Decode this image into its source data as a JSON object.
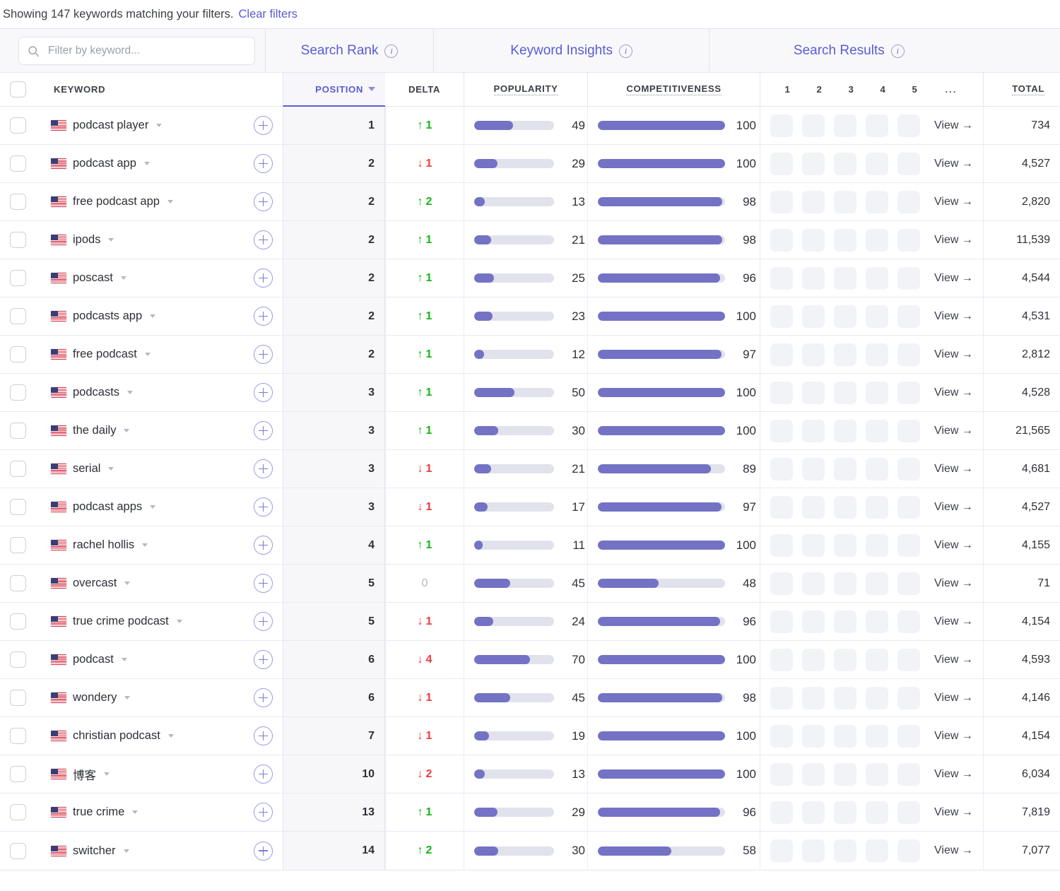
{
  "status": {
    "text": "Showing 147 keywords matching your filters.",
    "clear_label": "Clear filters"
  },
  "search": {
    "placeholder": "Filter by keyword...",
    "value": "",
    "icon": "search-icon"
  },
  "group_headers": [
    {
      "label": "Search Rank",
      "info_icon": "info-icon"
    },
    {
      "label": "Keyword Insights",
      "info_icon": "info-icon"
    },
    {
      "label": "Search Results",
      "info_icon": "info-icon"
    }
  ],
  "columns": {
    "keyword": "KEYWORD",
    "position": "POSITION",
    "position_sort_icon": "chevron-down-icon",
    "delta": "DELTA",
    "popularity": "POPULARITY",
    "competitiveness": "COMPETITIVENESS",
    "rank_slots": [
      "1",
      "2",
      "3",
      "4",
      "5"
    ],
    "rank_more": "...",
    "total": "TOTAL"
  },
  "row_actions": {
    "add_icon": "plus-icon",
    "view_label": "View →",
    "keyword_caret_icon": "caret-down-icon",
    "flag_icon": "us-flag-icon"
  },
  "colors": {
    "accent": "#5b5bd6",
    "bar_fill": "#7472c4",
    "bar_track": "#e2e2ed",
    "delta_up": "#16b516",
    "delta_down": "#ef3b3b",
    "delta_zero": "#b3b6bf",
    "placeholder_box": "#f1f3f7"
  },
  "chart_data": {
    "type": "table",
    "title": "Keyword rankings table",
    "columns": [
      "KEYWORD",
      "POSITION",
      "DELTA",
      "POPULARITY",
      "COMPETITIVENESS",
      "TOTAL"
    ],
    "series": [
      {
        "name": "POPULARITY",
        "values": [
          49,
          29,
          13,
          21,
          25,
          23,
          12,
          50,
          30,
          21,
          17,
          11,
          45,
          24,
          70,
          45,
          19,
          13,
          29,
          30
        ]
      },
      {
        "name": "COMPETITIVENESS",
        "values": [
          100,
          100,
          98,
          98,
          96,
          100,
          97,
          100,
          100,
          89,
          97,
          100,
          48,
          96,
          100,
          98,
          100,
          100,
          96,
          58
        ]
      }
    ],
    "categories": [
      "podcast player",
      "podcast app",
      "free podcast app",
      "ipods",
      "poscast",
      "podcasts app",
      "free podcast",
      "podcasts",
      "the daily",
      "serial",
      "podcast apps",
      "rachel hollis",
      "overcast",
      "true crime podcast",
      "podcast",
      "wondery",
      "christian podcast",
      "博客",
      "true crime",
      "switcher"
    ],
    "ylim": [
      0,
      100
    ]
  },
  "rows": [
    {
      "keyword": "podcast player",
      "position": "1",
      "delta": "1",
      "delta_dir": "up",
      "popularity": 49,
      "popularity_label": "49",
      "competitiveness": 100,
      "competitiveness_label": "100",
      "total": "734"
    },
    {
      "keyword": "podcast app",
      "position": "2",
      "delta": "1",
      "delta_dir": "down",
      "popularity": 29,
      "popularity_label": "29",
      "competitiveness": 100,
      "competitiveness_label": "100",
      "total": "4,527"
    },
    {
      "keyword": "free podcast app",
      "position": "2",
      "delta": "2",
      "delta_dir": "up",
      "popularity": 13,
      "popularity_label": "13",
      "competitiveness": 98,
      "competitiveness_label": "98",
      "total": "2,820"
    },
    {
      "keyword": "ipods",
      "position": "2",
      "delta": "1",
      "delta_dir": "up",
      "popularity": 21,
      "popularity_label": "21",
      "competitiveness": 98,
      "competitiveness_label": "98",
      "total": "11,539"
    },
    {
      "keyword": "poscast",
      "position": "2",
      "delta": "1",
      "delta_dir": "up",
      "popularity": 25,
      "popularity_label": "25",
      "competitiveness": 96,
      "competitiveness_label": "96",
      "total": "4,544"
    },
    {
      "keyword": "podcasts app",
      "position": "2",
      "delta": "1",
      "delta_dir": "up",
      "popularity": 23,
      "popularity_label": "23",
      "competitiveness": 100,
      "competitiveness_label": "100",
      "total": "4,531"
    },
    {
      "keyword": "free podcast",
      "position": "2",
      "delta": "1",
      "delta_dir": "up",
      "popularity": 12,
      "popularity_label": "12",
      "competitiveness": 97,
      "competitiveness_label": "97",
      "total": "2,812"
    },
    {
      "keyword": "podcasts",
      "position": "3",
      "delta": "1",
      "delta_dir": "up",
      "popularity": 50,
      "popularity_label": "50",
      "competitiveness": 100,
      "competitiveness_label": "100",
      "total": "4,528"
    },
    {
      "keyword": "the daily",
      "position": "3",
      "delta": "1",
      "delta_dir": "up",
      "popularity": 30,
      "popularity_label": "30",
      "competitiveness": 100,
      "competitiveness_label": "100",
      "total": "21,565"
    },
    {
      "keyword": "serial",
      "position": "3",
      "delta": "1",
      "delta_dir": "down",
      "popularity": 21,
      "popularity_label": "21",
      "competitiveness": 89,
      "competitiveness_label": "89",
      "total": "4,681"
    },
    {
      "keyword": "podcast apps",
      "position": "3",
      "delta": "1",
      "delta_dir": "down",
      "popularity": 17,
      "popularity_label": "17",
      "competitiveness": 97,
      "competitiveness_label": "97",
      "total": "4,527"
    },
    {
      "keyword": "rachel hollis",
      "position": "4",
      "delta": "1",
      "delta_dir": "up",
      "popularity": 11,
      "popularity_label": "11",
      "competitiveness": 100,
      "competitiveness_label": "100",
      "total": "4,155"
    },
    {
      "keyword": "overcast",
      "position": "5",
      "delta": "0",
      "delta_dir": "zero",
      "popularity": 45,
      "popularity_label": "45",
      "competitiveness": 48,
      "competitiveness_label": "48",
      "total": "71"
    },
    {
      "keyword": "true crime podcast",
      "position": "5",
      "delta": "1",
      "delta_dir": "down",
      "popularity": 24,
      "popularity_label": "24",
      "competitiveness": 96,
      "competitiveness_label": "96",
      "total": "4,154"
    },
    {
      "keyword": "podcast",
      "position": "6",
      "delta": "4",
      "delta_dir": "down",
      "popularity": 70,
      "popularity_label": "70",
      "competitiveness": 100,
      "competitiveness_label": "100",
      "total": "4,593"
    },
    {
      "keyword": "wondery",
      "position": "6",
      "delta": "1",
      "delta_dir": "down",
      "popularity": 45,
      "popularity_label": "45",
      "competitiveness": 98,
      "competitiveness_label": "98",
      "total": "4,146"
    },
    {
      "keyword": "christian podcast",
      "position": "7",
      "delta": "1",
      "delta_dir": "down",
      "popularity": 19,
      "popularity_label": "19",
      "competitiveness": 100,
      "competitiveness_label": "100",
      "total": "4,154"
    },
    {
      "keyword": "博客",
      "position": "10",
      "delta": "2",
      "delta_dir": "down",
      "popularity": 13,
      "popularity_label": "13",
      "competitiveness": 100,
      "competitiveness_label": "100",
      "total": "6,034"
    },
    {
      "keyword": "true crime",
      "position": "13",
      "delta": "1",
      "delta_dir": "up",
      "popularity": 29,
      "popularity_label": "29",
      "competitiveness": 96,
      "competitiveness_label": "96",
      "total": "7,819"
    },
    {
      "keyword": "switcher",
      "position": "14",
      "delta": "2",
      "delta_dir": "up",
      "popularity": 30,
      "popularity_label": "30",
      "competitiveness": 58,
      "competitiveness_label": "58",
      "total": "7,077"
    }
  ]
}
